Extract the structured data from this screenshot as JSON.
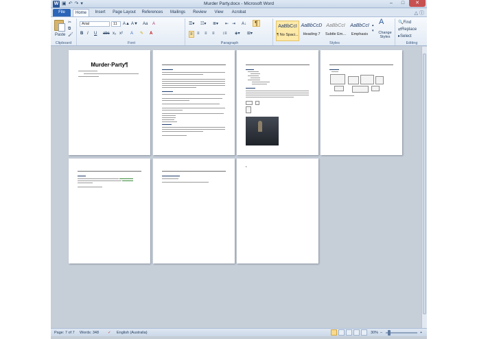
{
  "window": {
    "title": "Murder Party.docx - Microsoft Word",
    "app_icon": "W",
    "qat": [
      "save-icon",
      "undo-icon",
      "redo-icon",
      "customize-icon"
    ],
    "controls": {
      "minimize": "–",
      "maximize": "□",
      "close": "✕"
    }
  },
  "ribbon": {
    "tabs": [
      "File",
      "Home",
      "Insert",
      "Page Layout",
      "References",
      "Mailings",
      "Review",
      "View",
      "Acrobat"
    ],
    "active_tab": "Home",
    "clipboard": {
      "paste": "Paste",
      "label": "Clipboard"
    },
    "font": {
      "name": "Arial",
      "size": "11",
      "label": "Font",
      "bold": "B",
      "italic": "I",
      "underline": "U",
      "strike": "abc",
      "sub": "x₂",
      "sup": "x²",
      "grow": "A▲",
      "shrink": "A▼",
      "case": "Aa",
      "clear": "A",
      "color": "A"
    },
    "paragraph": {
      "label": "Paragraph",
      "pilcrow": "¶"
    },
    "styles": {
      "label": "Styles",
      "items": [
        {
          "sample": "AaBbCcI",
          "name": "¶ No Spaci..."
        },
        {
          "sample": "AaBbCcD",
          "name": "Heading 7"
        },
        {
          "sample": "AaBbCcI",
          "name": "Subtle Em..."
        },
        {
          "sample": "AaBbCcI",
          "name": "Emphasis"
        }
      ],
      "change_styles": "Change Styles"
    },
    "editing": {
      "label": "Editing",
      "find": "Find",
      "replace": "Replace",
      "select": "Select"
    }
  },
  "document": {
    "page1_title": "Murder·Party¶"
  },
  "status": {
    "page": "Page: 7 of 7",
    "words": "Words: 348",
    "language": "English (Australia)",
    "zoom": "30%",
    "zoom_minus": "–",
    "zoom_plus": "+",
    "zoom_level": 0.3
  },
  "colors": {
    "accent": "#2b579a",
    "file_tab": "#2b65b8"
  }
}
